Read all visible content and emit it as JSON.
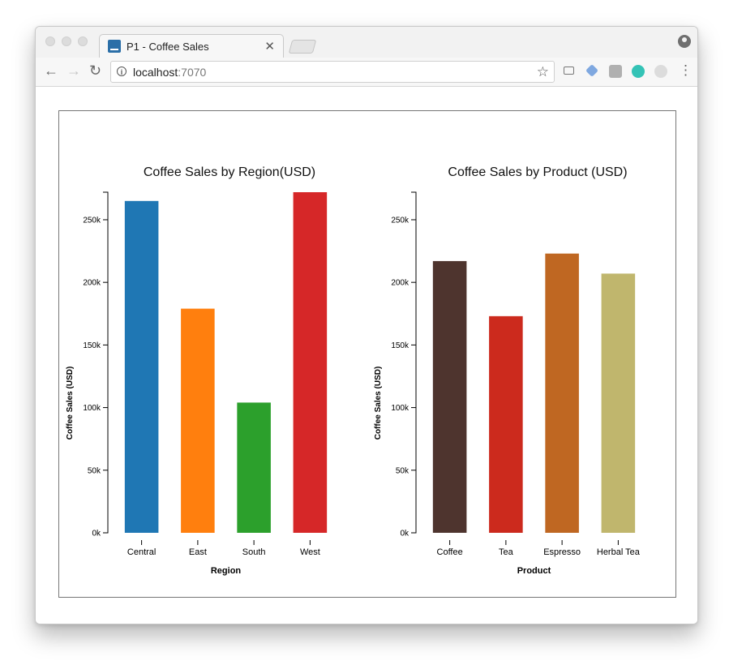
{
  "browser": {
    "tab_title": "P1 - Coffee Sales",
    "url_host": "localhost",
    "url_port": ":7070",
    "close_glyph": "✕",
    "back_glyph": "←",
    "forward_glyph": "→",
    "reload_glyph": "↻",
    "star_glyph": "☆",
    "info_glyph": "i",
    "menu_glyph": "⋮",
    "icons": [
      "back-icon",
      "forward-icon",
      "reload-icon",
      "info-icon",
      "star-icon",
      "cast-icon",
      "extension-icon",
      "menu-icon",
      "profile-icon"
    ]
  },
  "chart_data": [
    {
      "type": "bar",
      "title": "Coffee Sales by Region(USD)",
      "xlabel": "Region",
      "ylabel": "Coffee Sales (USD)",
      "categories": [
        "Central",
        "East",
        "South",
        "West"
      ],
      "values": [
        265000,
        179000,
        104000,
        272000
      ],
      "colors": [
        "#1f77b4",
        "#ff7f0e",
        "#2ca02c",
        "#d62728"
      ],
      "ylim": [
        0,
        272000
      ],
      "yticks": [
        0,
        50000,
        100000,
        150000,
        200000,
        250000
      ],
      "ytick_labels": [
        "0k",
        "50k",
        "100k",
        "150k",
        "200k",
        "250k"
      ],
      "grid": false
    },
    {
      "type": "bar",
      "title": "Coffee Sales by Product (USD)",
      "xlabel": "Product",
      "ylabel": "Coffee Sales (USD)",
      "categories": [
        "Coffee",
        "Tea",
        "Espresso",
        "Herbal Tea"
      ],
      "values": [
        217000,
        173000,
        223000,
        207000
      ],
      "colors": [
        "#4e342e",
        "#cc2a1d",
        "#bf6722",
        "#c0b66d"
      ],
      "ylim": [
        0,
        272000
      ],
      "yticks": [
        0,
        50000,
        100000,
        150000,
        200000,
        250000
      ],
      "ytick_labels": [
        "0k",
        "50k",
        "100k",
        "150k",
        "200k",
        "250k"
      ],
      "grid": false
    }
  ]
}
